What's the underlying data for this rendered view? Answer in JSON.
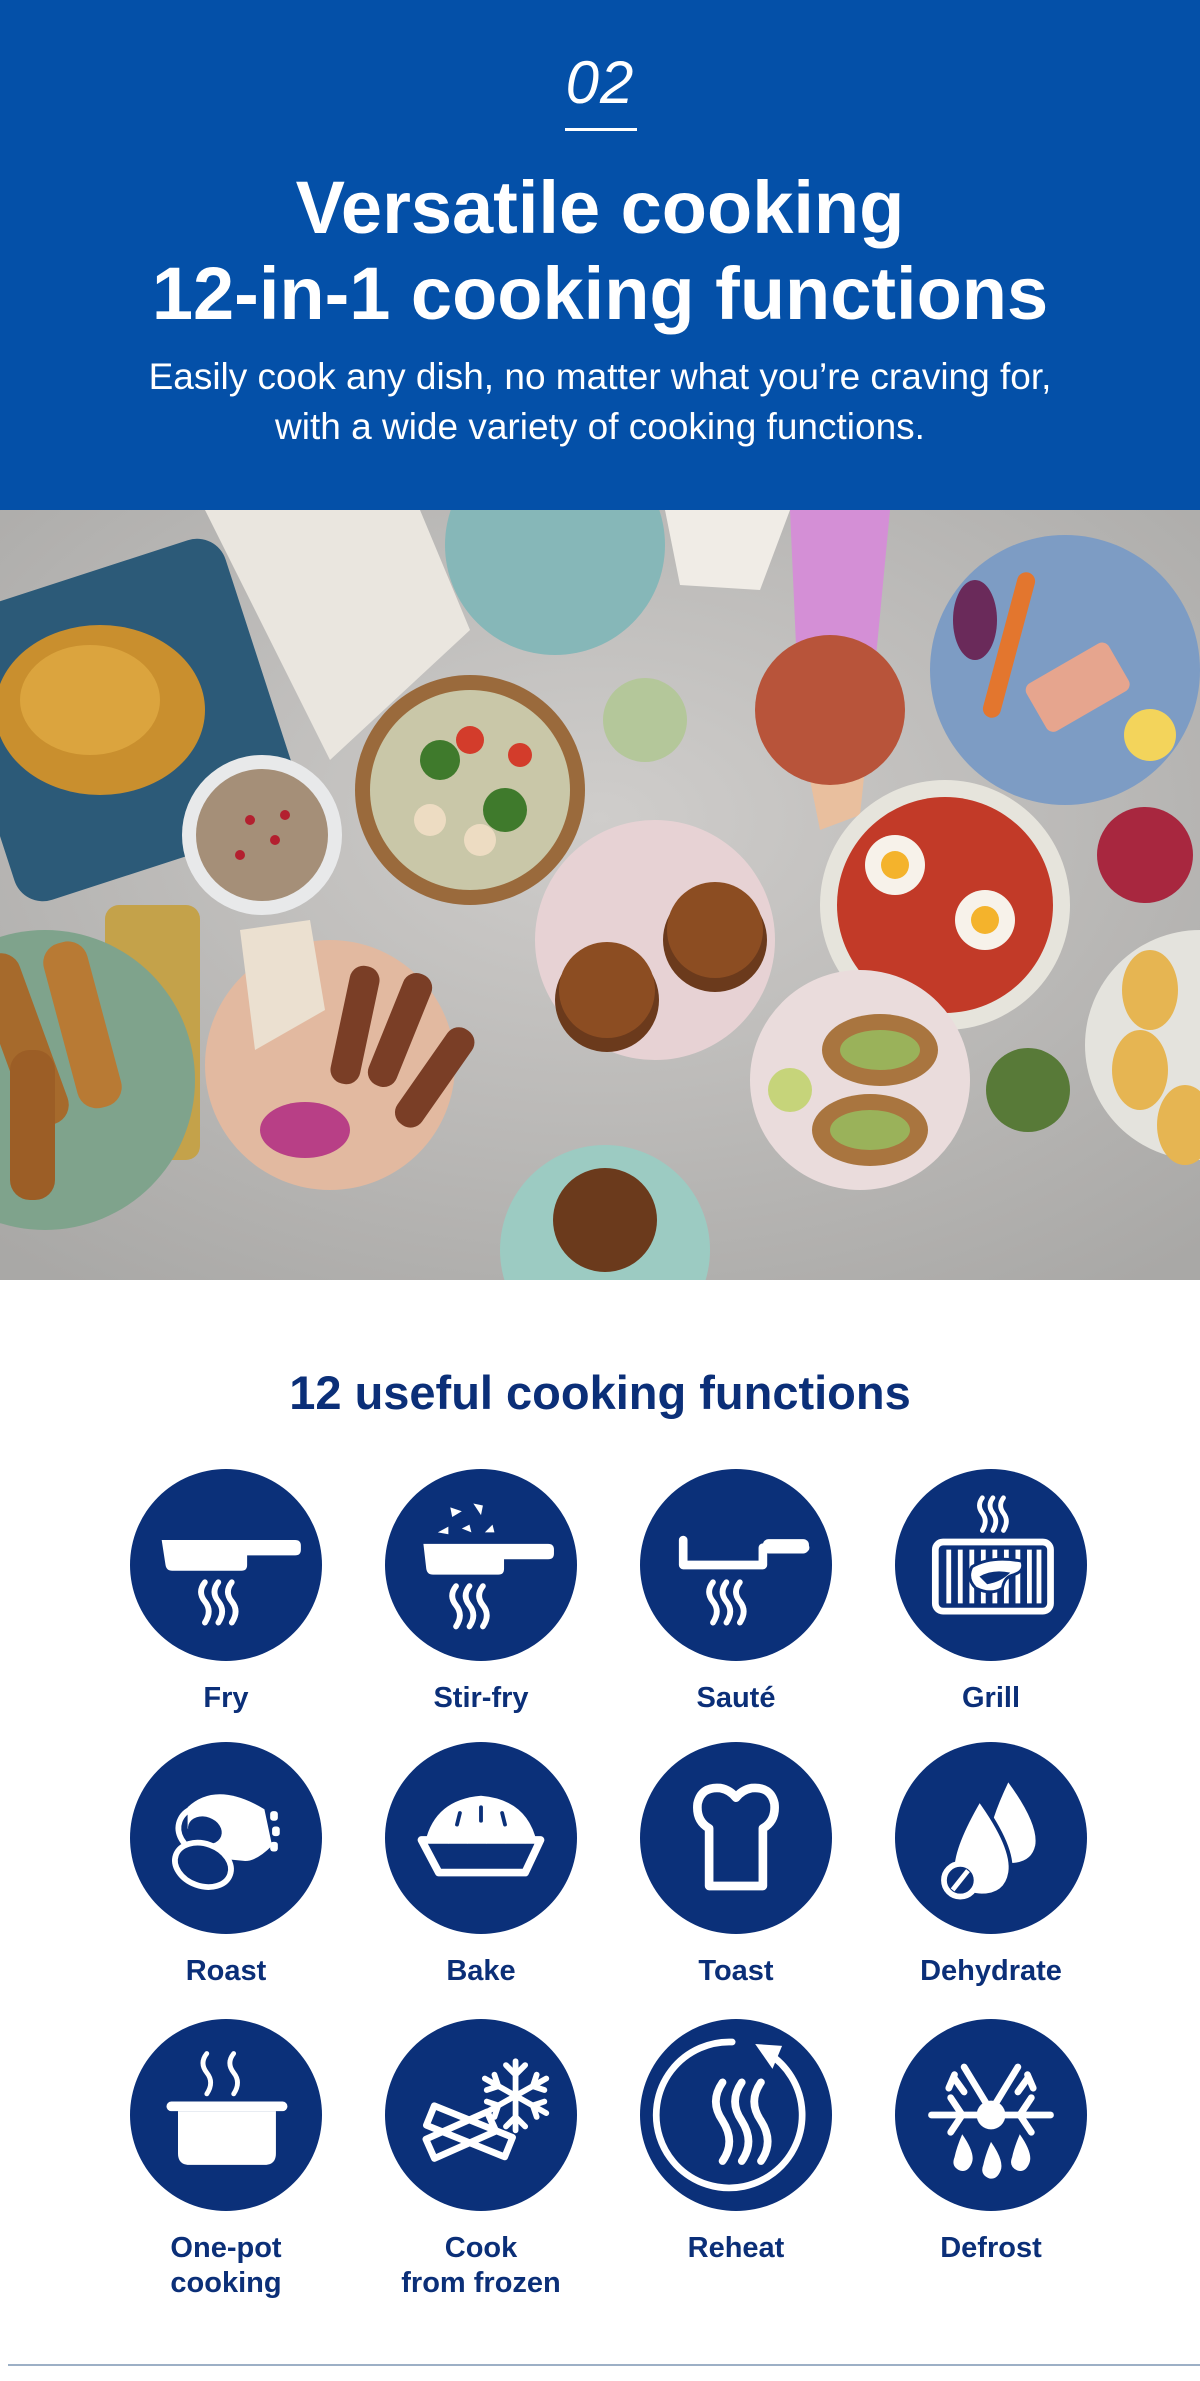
{
  "hero": {
    "step_number": "02",
    "title_line1": "Versatile cooking",
    "title_line2": "12-in-1 cooking functions",
    "subtitle_line1": "Easily cook any dish, no matter what you’re craving for,",
    "subtitle_line2": "with a wide variety of cooking functions.",
    "background_color": "#0450A8"
  },
  "photo": {
    "description": "Overhead view of a table with many dishes: roast chicken, dip with pomegranate, vegetable curry, burgers, kebabs with flatbread, chicken drumsticks, roasted vegetables with salmon, shakshuka, stuffed potatoes, beet dip, pastries"
  },
  "functions": {
    "title": "12 useful cooking functions",
    "icon_color": "#0B3079",
    "items": [
      {
        "label": "Fry",
        "icon": "frying-pan-icon"
      },
      {
        "label": "Stir-fry",
        "icon": "stir-fry-pan-icon"
      },
      {
        "label": "Sauté",
        "icon": "saute-pan-icon"
      },
      {
        "label": "Grill",
        "icon": "grill-steak-icon"
      },
      {
        "label": "Roast",
        "icon": "roast-meat-icon"
      },
      {
        "label": "Bake",
        "icon": "pie-icon"
      },
      {
        "label": "Toast",
        "icon": "bread-slice-icon"
      },
      {
        "label": "Dehydrate",
        "icon": "drops-icon"
      },
      {
        "label": "One-pot\ncooking",
        "label_line1": "One-pot",
        "label_line2": "cooking",
        "icon": "pot-icon"
      },
      {
        "label": "Cook\nfrom frozen",
        "label_line1": "Cook",
        "label_line2": "from frozen",
        "icon": "frozen-food-icon"
      },
      {
        "label": "Reheat",
        "icon": "reheat-icon"
      },
      {
        "label": "Defrost",
        "icon": "defrost-icon"
      }
    ]
  }
}
